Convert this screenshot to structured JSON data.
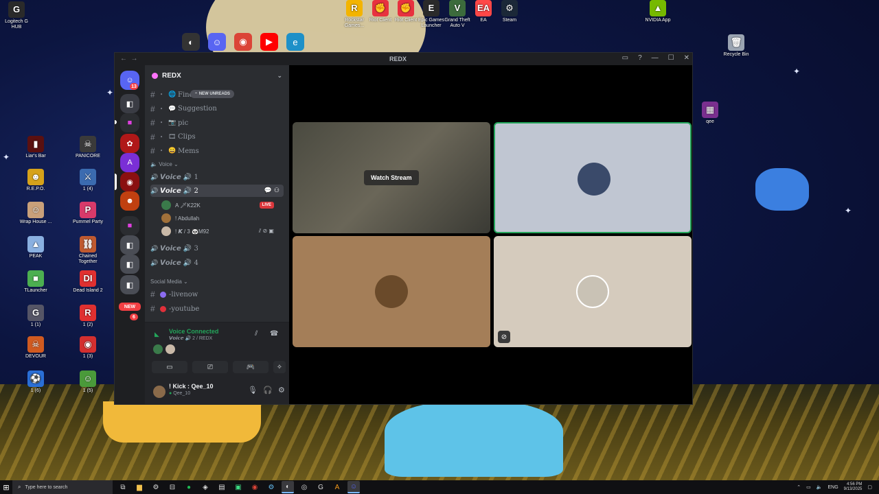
{
  "desktop": {
    "top_icons": [
      {
        "label": "Logitech G HUB",
        "color": "#2a2a2a",
        "glyph": "G"
      },
      {
        "label": "Rockstar Games...",
        "color": "#f3b400",
        "glyph": "R"
      },
      {
        "label": "Riot Client",
        "color": "#e8313f",
        "glyph": "✊"
      },
      {
        "label": "Riot Client",
        "color": "#e8313f",
        "glyph": "✊"
      },
      {
        "label": "Epic Games Launcher",
        "color": "#2a2a2a",
        "glyph": "E"
      },
      {
        "label": "Grand Theft Auto V",
        "color": "#3c6b3c",
        "glyph": "V"
      },
      {
        "label": "EA",
        "color": "#ff4747",
        "glyph": "EA"
      },
      {
        "label": "Steam",
        "color": "#1b2838",
        "glyph": "⚙"
      },
      {
        "label": "NVIDIA App",
        "color": "#76b900",
        "glyph": "▲"
      },
      {
        "label": "Recycle Bin",
        "color": "#9aa4b2",
        "glyph": "🗑"
      },
      {
        "label": "qee",
        "color": "#7a2f8f",
        "glyph": "▦"
      }
    ],
    "left_icons": [
      {
        "label": "Liar's Bar",
        "color": "#5a1010",
        "glyph": "▮"
      },
      {
        "label": "PANICORE",
        "color": "#3a3a3a",
        "glyph": "☠"
      },
      {
        "label": "R.E.P.O.",
        "color": "#d6a21a",
        "glyph": "☻"
      },
      {
        "label": "1 (4)",
        "color": "#3b6bb0",
        "glyph": "⚔"
      },
      {
        "label": "Wrap House ...",
        "color": "#c9a07a",
        "glyph": "☺"
      },
      {
        "label": "Pummel Party",
        "color": "#d83a6a",
        "glyph": "P"
      },
      {
        "label": "PEAK",
        "color": "#8ab0e0",
        "glyph": "▲"
      },
      {
        "label": "Chained Together",
        "color": "#c05a30",
        "glyph": "⛓"
      },
      {
        "label": "TLauncher",
        "color": "#4caf50",
        "glyph": "■"
      },
      {
        "label": "Dead Island 2",
        "color": "#e03030",
        "glyph": "DI"
      },
      {
        "label": "1 (1)",
        "color": "#556",
        "glyph": "G"
      },
      {
        "label": "1 (2)",
        "color": "#e03030",
        "glyph": "R"
      },
      {
        "label": "DEVOUR",
        "color": "#d05a20",
        "glyph": "☠"
      },
      {
        "label": "1 (3)",
        "color": "#d32f2f",
        "glyph": "◉"
      },
      {
        "label": "1 (6)",
        "color": "#2a6fd6",
        "glyph": "⚽"
      },
      {
        "label": "1 (5)",
        "color": "#4a9a3a",
        "glyph": "☺"
      }
    ],
    "quick_launch": [
      {
        "name": "davinci-icon",
        "color": "#333",
        "glyph": "◐"
      },
      {
        "name": "discord-icon",
        "color": "#5865f2",
        "glyph": "☺"
      },
      {
        "name": "chrome-icon",
        "color": "#db4437",
        "glyph": "◉"
      },
      {
        "name": "youtube-icon",
        "color": "#ff0000",
        "glyph": "▶"
      },
      {
        "name": "edge-icon",
        "color": "#1e90c8",
        "glyph": "e"
      }
    ]
  },
  "window": {
    "title": "REDX"
  },
  "server_rail": {
    "home_badge": "13",
    "new_label": "NEW",
    "new_badge": "6"
  },
  "server": {
    "name": "REDX",
    "new_unreads": "NEW UNREADS",
    "channels": [
      {
        "name": "Find-player",
        "emoji": "🌐"
      },
      {
        "name": "Suggestion",
        "emoji": "💬"
      },
      {
        "name": "pic",
        "emoji": "📷"
      },
      {
        "name": "Clips",
        "emoji": "🎞"
      },
      {
        "name": "Mems",
        "emoji": "😀"
      }
    ],
    "voice_category": "Voice",
    "voice_channels": [
      {
        "name": "𝙑𝙤𝙞𝙘𝙚 🔊 1"
      },
      {
        "name": "𝙑𝙤𝙞𝙘𝙚 🔊 2"
      },
      {
        "name": "𝙑𝙤𝙞𝙘𝙚 🔊 3"
      },
      {
        "name": "𝙑𝙤𝙞𝙘𝙚 🔊 4"
      }
    ],
    "voice_users": [
      {
        "name": "A 🗡K22K",
        "live": "LIVE",
        "color": "#3a7a4a"
      },
      {
        "name": "! Abdullah",
        "color": "#a0703a"
      },
      {
        "name": "! 𝙆 / 3 🐼M92",
        "color": "#c9b9a8"
      }
    ],
    "social_category": "Social Media",
    "social_channels": [
      {
        "name": "-livenow",
        "dot": "#8b6cf0"
      },
      {
        "name": "-youtube",
        "dot": "#e0303a"
      }
    ]
  },
  "voice_panel": {
    "status": "Voice Connected",
    "channel": "𝙑𝙤𝙞𝙘𝙚 🔊 2 / REDX"
  },
  "user": {
    "display": "! Kick : Qee_10",
    "tag": "Qee_10"
  },
  "stage": {
    "watch_stream": "Watch Stream"
  },
  "taskbar": {
    "search_placeholder": "Type here to search",
    "lang": "ENG",
    "time": "4:56 PM",
    "date": "9/13/2025"
  }
}
